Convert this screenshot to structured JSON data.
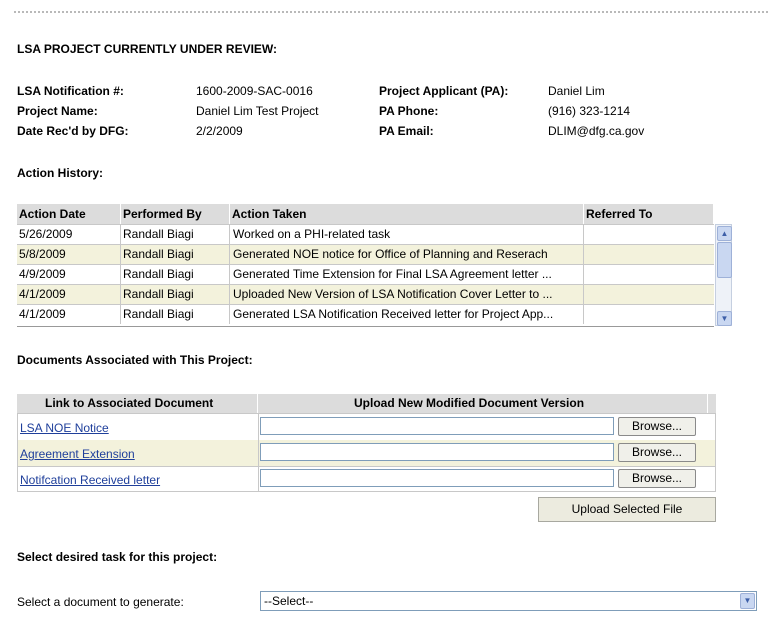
{
  "review": {
    "heading": "LSA PROJECT CURRENTLY UNDER REVIEW:",
    "notification_label": "LSA Notification #:",
    "notification_value": "1600-2009-SAC-0016",
    "project_name_label": "Project Name:",
    "project_name_value": "Daniel Lim Test Project",
    "date_label": "Date Rec'd by DFG:",
    "date_value": "2/2/2009",
    "applicant_label": "Project Applicant (PA):",
    "applicant_value": "Daniel Lim",
    "phone_label": "PA Phone:",
    "phone_value": "(916) 323-1214",
    "email_label": "PA Email:",
    "email_value": "DLIM@dfg.ca.gov"
  },
  "history": {
    "heading": "Action History:",
    "columns": [
      "Action Date",
      "Performed By",
      "Action Taken",
      "Referred To"
    ],
    "rows": [
      {
        "date": "5/26/2009",
        "by": "Randall Biagi",
        "action": "Worked on a PHI-related task",
        "referred": ""
      },
      {
        "date": "5/8/2009",
        "by": "Randall Biagi",
        "action": "Generated NOE notice for Office of Planning and Reserach",
        "referred": ""
      },
      {
        "date": "4/9/2009",
        "by": "Randall Biagi",
        "action": "Generated Time Extension for Final LSA Agreement letter ...",
        "referred": ""
      },
      {
        "date": "4/1/2009",
        "by": "Randall Biagi",
        "action": "Uploaded New Version of LSA Notification Cover Letter to ...",
        "referred": ""
      },
      {
        "date": "4/1/2009",
        "by": "Randall Biagi",
        "action": "Generated LSA Notification Received letter for Project App...",
        "referred": ""
      }
    ]
  },
  "documents": {
    "heading": "Documents Associated with This Project:",
    "col_link": "Link to Associated Document",
    "col_upload": "Upload New Modified Document Version",
    "rows": [
      {
        "link": "LSA NOE Notice",
        "browse": "Browse..."
      },
      {
        "link": "Agreement Extension",
        "browse": "Browse..."
      },
      {
        "link": "Notifcation Received letter",
        "browse": "Browse..."
      }
    ],
    "upload_button": "Upload Selected File"
  },
  "task": {
    "heading": "Select desired task for this project:",
    "generate_label": "Select a document to generate:",
    "generate_selected": "--Select--"
  },
  "icons": {
    "scroll_up": "chevron-up-icon",
    "scroll_down": "chevron-down-icon",
    "select_arrow": "chevron-down-icon"
  }
}
